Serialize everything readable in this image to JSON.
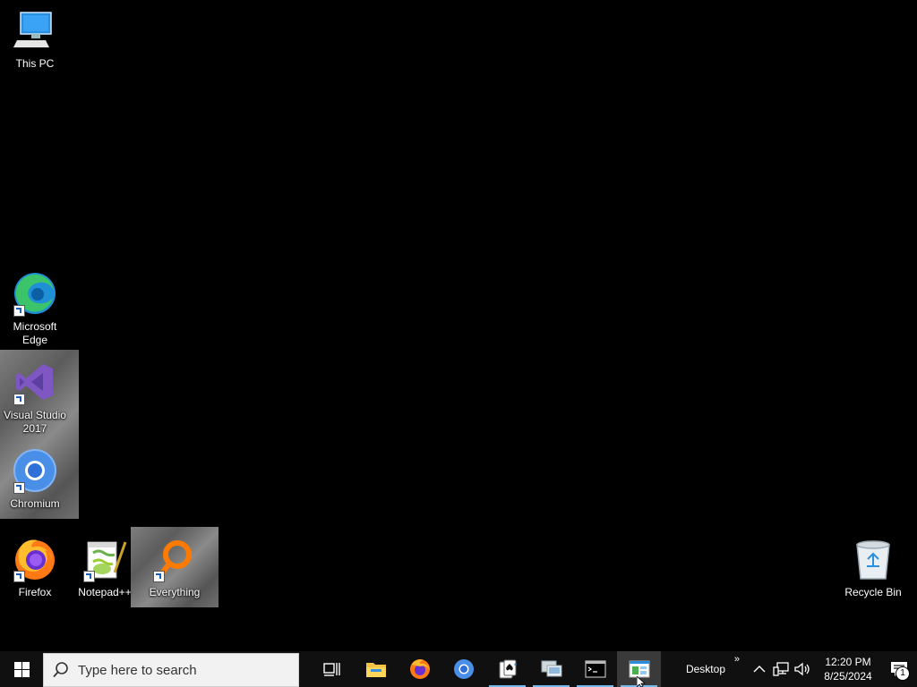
{
  "desktop": {
    "icons": [
      {
        "label": "This PC"
      },
      {
        "label": "Microsoft Edge"
      },
      {
        "label": "Visual Studio 2017"
      },
      {
        "label": "Chromium"
      },
      {
        "label": "Firefox"
      },
      {
        "label": "Notepad++"
      },
      {
        "label": "Everything"
      },
      {
        "label": "Recycle Bin"
      }
    ]
  },
  "taskbar": {
    "search": {
      "placeholder": "Type here to search"
    },
    "apps": [
      {
        "icon": "task-view-icon"
      },
      {
        "icon": "file-explorer-icon"
      },
      {
        "icon": "firefox-icon"
      },
      {
        "icon": "chromium-icon"
      },
      {
        "icon": "solitaire-icon"
      },
      {
        "icon": "remote-desktop-icon"
      },
      {
        "icon": "command-prompt-icon"
      },
      {
        "icon": "window-app-icon"
      }
    ],
    "tray": {
      "toolbar_label": "Desktop",
      "toolbar_chevron": "»",
      "time": "12:20 PM",
      "date": "8/25/2024",
      "notification_count": "1"
    }
  },
  "colors": {
    "desktop_background": "#000000",
    "taskbar_background": "#101010",
    "running_indicator": "#76b9ed"
  }
}
